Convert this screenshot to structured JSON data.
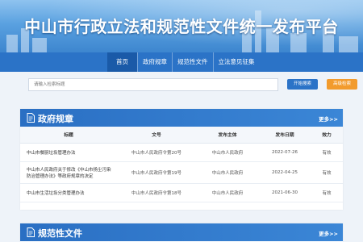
{
  "banner": {
    "title": "中山市行政立法和规范性文件统一发布平台"
  },
  "nav": {
    "items": [
      "首页",
      "政府规章",
      "规范性文件",
      "立法意见征集"
    ]
  },
  "search": {
    "placeholder": "请输入检索标题",
    "search_label": "开始搜索",
    "advanced_label": "高级检索"
  },
  "colors": {
    "primary": "#2b73c7",
    "accent": "#f29b2d",
    "nav_active": "#1a5aa8"
  },
  "sections": {
    "rules": {
      "title": "政府规章",
      "icon": "document-icon",
      "more": "更多>>",
      "columns": [
        "标题",
        "文号",
        "发布主体",
        "发布日期",
        "效力"
      ],
      "rows": [
        [
          "中山市餐厨垃圾管理办法",
          "中山市人民政府令第20号",
          "中山市人民政府",
          "2022-07-26",
          "有效"
        ],
        [
          "中山市人民政府关于修改《中山市扬尘污染防治管理办法》等政府规章的决定",
          "中山市人民政府令第19号",
          "中山市人民政府",
          "2022-04-25",
          "有效"
        ],
        [
          "中山市生活垃圾分类管理办法",
          "中山市人民政府令第18号",
          "中山市人民政府",
          "2021-06-30",
          "有效"
        ]
      ]
    },
    "normative": {
      "title": "规范性文件",
      "icon": "document-icon",
      "more": "更多>>"
    }
  }
}
